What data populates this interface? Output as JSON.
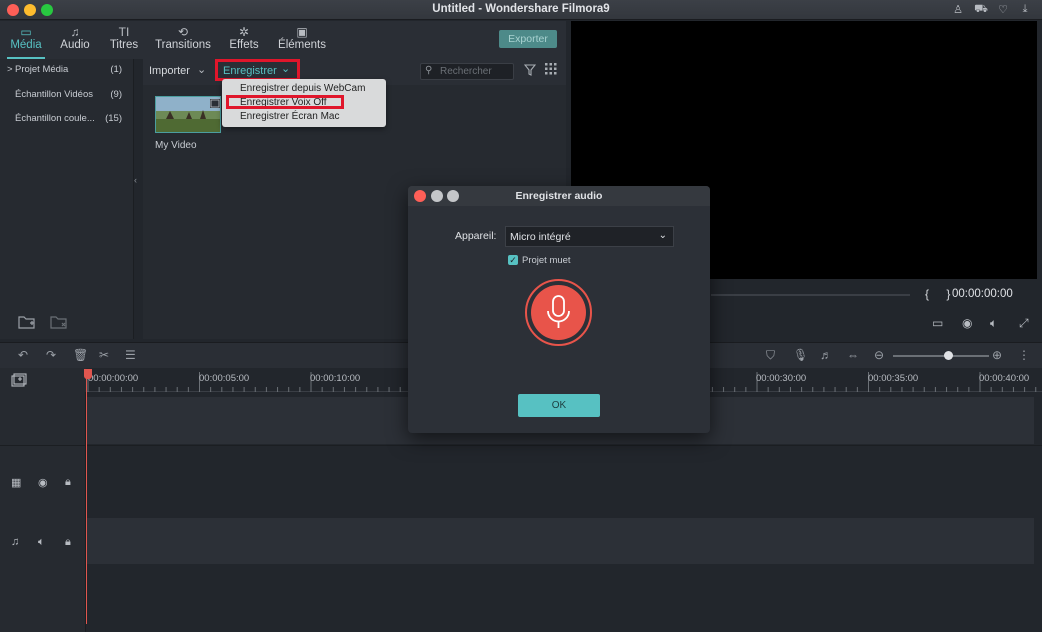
{
  "window": {
    "title": "Untitled - Wondershare Filmora9",
    "traffic_colors": [
      "#fe5f57",
      "#febc2e",
      "#28c840"
    ]
  },
  "tabs": [
    {
      "label": "Média",
      "icon": "folder-icon",
      "glyph": "▭"
    },
    {
      "label": "Audio",
      "icon": "music-note-icon",
      "glyph": "♫"
    },
    {
      "label": "Titres",
      "icon": "title-text-icon",
      "glyph": "TI"
    },
    {
      "label": "Transitions",
      "icon": "transition-icon",
      "glyph": "⟲"
    },
    {
      "label": "Effets",
      "icon": "effects-icon",
      "glyph": "✲"
    },
    {
      "label": "Éléments",
      "icon": "image-icon",
      "glyph": "▣"
    }
  ],
  "export_label": "Exporter",
  "sidebar": {
    "items": [
      {
        "label": "Projet Média",
        "count": "(1)",
        "arrow": ">"
      },
      {
        "label": "Échantillon Vidéos",
        "count": "(9)"
      },
      {
        "label": "Échantillon coule...",
        "count": "(15)"
      }
    ]
  },
  "toolbar": {
    "import_label": "Importer",
    "record_label": "Enregistrer",
    "search_placeholder": "Rechercher"
  },
  "dropdown": {
    "items": [
      "Enregistrer depuis WebCam",
      "Enregistrer Voix Off",
      "Enregistrer Écran Mac"
    ]
  },
  "media": {
    "item_label": "My Video"
  },
  "preview": {
    "timecode": "00:00:00:00",
    "brackets": "{ }"
  },
  "timeline": {
    "ticks": [
      "00:00:00:00",
      "00:00:05:00",
      "00:00:10:00",
      "00:00:30:00",
      "00:00:35:00",
      "00:00:40:00"
    ]
  },
  "dialog": {
    "title": "Enregistrer audio",
    "device_label": "Appareil:",
    "device_value": "Micro intégré",
    "mute_label": "Projet muet",
    "mute_checked": true,
    "ok_label": "OK"
  },
  "colors": {
    "accent": "#57c1c2",
    "highlight": "#e0162b",
    "record": "#e8544a"
  }
}
